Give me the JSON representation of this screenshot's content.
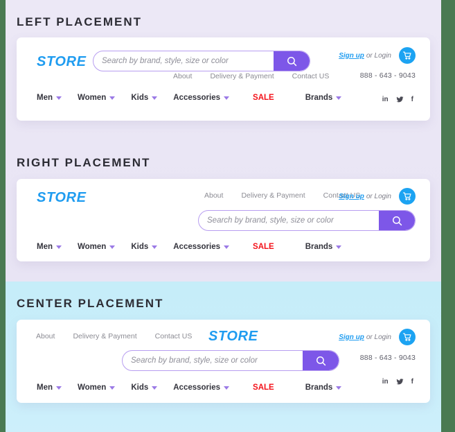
{
  "colors": {
    "page_border": "#4a7a52",
    "band_lavender": "#eae6f5",
    "band_cyan": "#c9eefa",
    "card": "#ffffff",
    "logo_blue": "#1f9cf0",
    "search_purple": "#7d57e8",
    "search_border": "#b79df0",
    "cart_blue": "#1ca3f2",
    "sale_red": "#f4121a",
    "caret_purple": "#9b7ae6",
    "nav_text": "#33333c",
    "muted_text": "#8b8b93",
    "title_text": "#2c2c34"
  },
  "sections": [
    {
      "id": "left-placement",
      "title": "LEFT PLACEMENT",
      "layout": "left"
    },
    {
      "id": "right-placement",
      "title": "RIGHT PLACEMENT",
      "layout": "right"
    },
    {
      "id": "center-placement",
      "title": "CENTER PLACEMENT",
      "layout": "center"
    }
  ],
  "header": {
    "logo": "STORE",
    "search": {
      "placeholder": "Search by brand, style, size or color",
      "value": "",
      "icon": "search-icon",
      "button_label": ""
    },
    "top_links": [
      {
        "label": "About"
      },
      {
        "label": "Delivery & Payment"
      },
      {
        "label": "Contact US"
      }
    ],
    "account": {
      "signup_label": "Sign up",
      "or_login_label": "or Login",
      "cart_icon": "shopping-cart-icon"
    },
    "phone": "888 - 643 - 9043",
    "nav": [
      {
        "label": "Men",
        "caret": true,
        "sale": false
      },
      {
        "label": "Women",
        "caret": true,
        "sale": false
      },
      {
        "label": "Kids",
        "caret": true,
        "sale": false
      },
      {
        "label": "Accessories",
        "caret": true,
        "sale": false
      },
      {
        "label": "SALE",
        "caret": false,
        "sale": true
      },
      {
        "label": "Brands",
        "caret": true,
        "sale": false
      }
    ],
    "socials": [
      {
        "name": "linkedin-icon",
        "glyph": "in"
      },
      {
        "name": "twitter-icon",
        "glyph": ""
      },
      {
        "name": "facebook-icon",
        "glyph": "f"
      }
    ]
  }
}
